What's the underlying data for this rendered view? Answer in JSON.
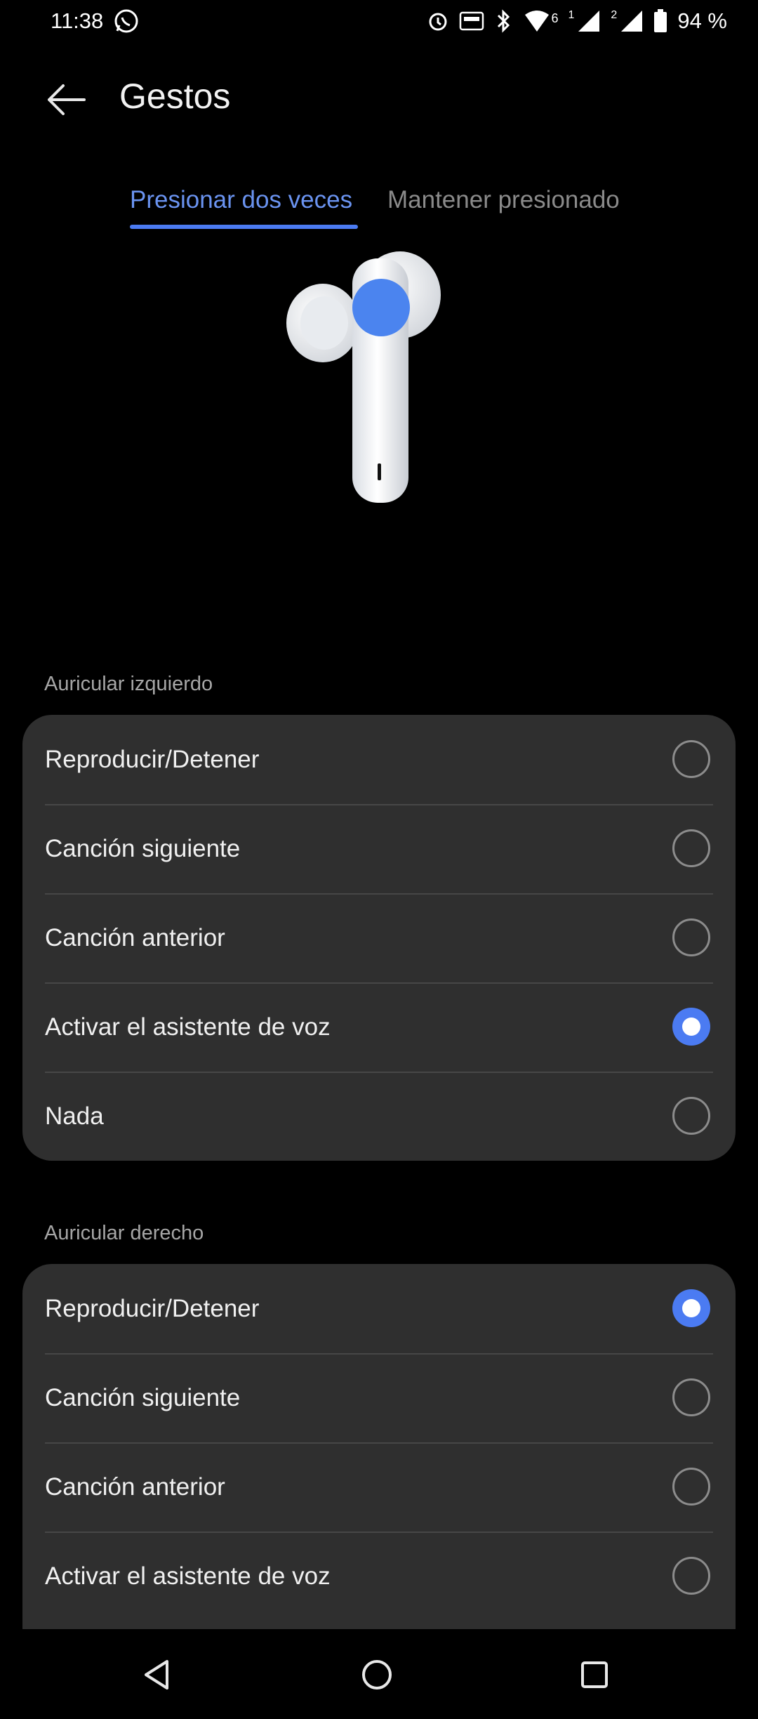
{
  "status_bar": {
    "time": "11:38",
    "signal_sim1": "1",
    "signal_sim2": "2",
    "battery": "94 %",
    "network_badge": "6"
  },
  "header": {
    "title": "Gestos"
  },
  "tabs": [
    {
      "label": "Presionar dos veces",
      "active": true
    },
    {
      "label": "Mantener presionado",
      "active": false
    }
  ],
  "colors": {
    "accent": "#4b7bf2",
    "card": "#2f2f2f",
    "background": "#000000"
  },
  "left_earbud": {
    "label": "Auricular izquierdo",
    "options": [
      {
        "label": "Reproducir/Detener",
        "selected": false
      },
      {
        "label": "Canción siguiente",
        "selected": false
      },
      {
        "label": "Canción anterior",
        "selected": false
      },
      {
        "label": "Activar el asistente de voz",
        "selected": true
      },
      {
        "label": "Nada",
        "selected": false
      }
    ]
  },
  "right_earbud": {
    "label": "Auricular derecho",
    "options": [
      {
        "label": "Reproducir/Detener",
        "selected": true
      },
      {
        "label": "Canción siguiente",
        "selected": false
      },
      {
        "label": "Canción anterior",
        "selected": false
      },
      {
        "label": "Activar el asistente de voz",
        "selected": false
      }
    ]
  },
  "nav": {
    "icons": [
      "back-triangle-icon",
      "home-circle-icon",
      "recents-square-icon"
    ]
  }
}
